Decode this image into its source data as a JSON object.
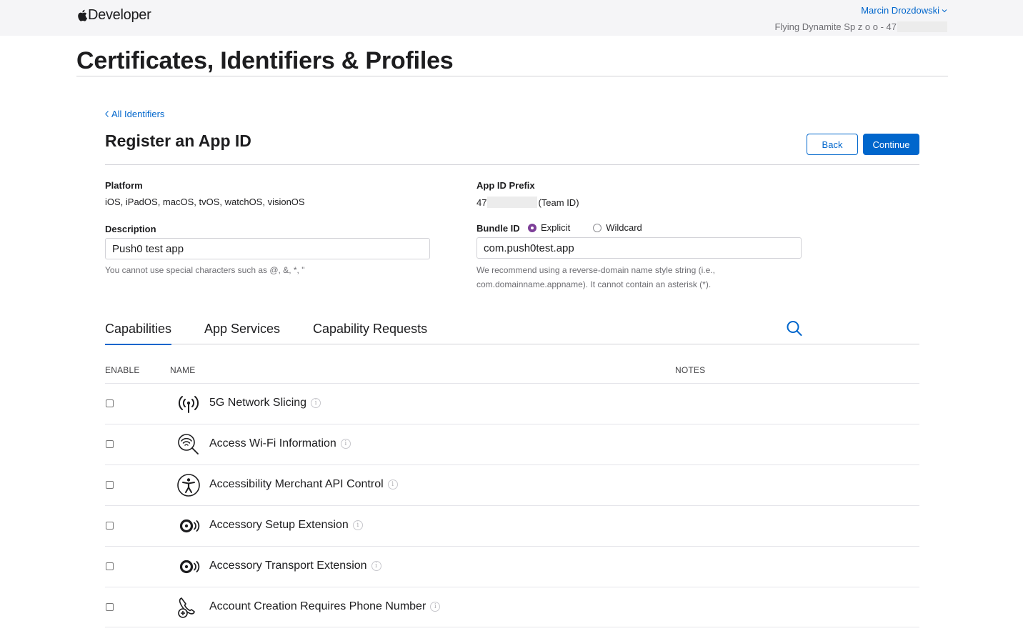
{
  "header": {
    "brand": "Developer",
    "user_name": "Marcin Drozdowski",
    "team_name": "Flying Dynamite Sp z o o - 47"
  },
  "page_title": "Certificates, Identifiers & Profiles",
  "back_link": "All Identifiers",
  "section_title": "Register an App ID",
  "buttons": {
    "back": "Back",
    "continue": "Continue"
  },
  "platform": {
    "label": "Platform",
    "value": "iOS, iPadOS, macOS, tvOS, watchOS, visionOS"
  },
  "prefix": {
    "label": "App ID Prefix",
    "value_start": "47",
    "value_end": "(Team ID)"
  },
  "description": {
    "label": "Description",
    "value": "Push0 test app",
    "hint": "You cannot use special characters such as @, &, *, \""
  },
  "bundle": {
    "label": "Bundle ID",
    "explicit": "Explicit",
    "wildcard": "Wildcard",
    "selected": "Explicit",
    "value": "com.push0test.app",
    "hint_line1": "We recommend using a reverse-domain name style string (i.e.,",
    "hint_line2": "com.domainname.appname). It cannot contain an asterisk (*)."
  },
  "tabs": [
    "Capabilities",
    "App Services",
    "Capability Requests"
  ],
  "active_tab": "Capabilities",
  "table": {
    "headers": {
      "enable": "ENABLE",
      "name": "NAME",
      "notes": "NOTES"
    },
    "rows": [
      {
        "name": "5G Network Slicing",
        "icon": "antenna-icon",
        "enabled": false
      },
      {
        "name": "Access Wi-Fi Information",
        "icon": "wifi-search-icon",
        "enabled": false
      },
      {
        "name": "Accessibility Merchant API Control",
        "icon": "accessibility-icon",
        "enabled": false
      },
      {
        "name": "Accessory Setup Extension",
        "icon": "accessory-icon",
        "enabled": false
      },
      {
        "name": "Accessory Transport Extension",
        "icon": "accessory-icon",
        "enabled": false
      },
      {
        "name": "Account Creation Requires Phone Number",
        "icon": "phone-add-icon",
        "enabled": false
      }
    ]
  },
  "colors": {
    "accent": "#0066cc",
    "radio_selected": "#7d3f98",
    "header_bg": "#f5f5f7"
  }
}
